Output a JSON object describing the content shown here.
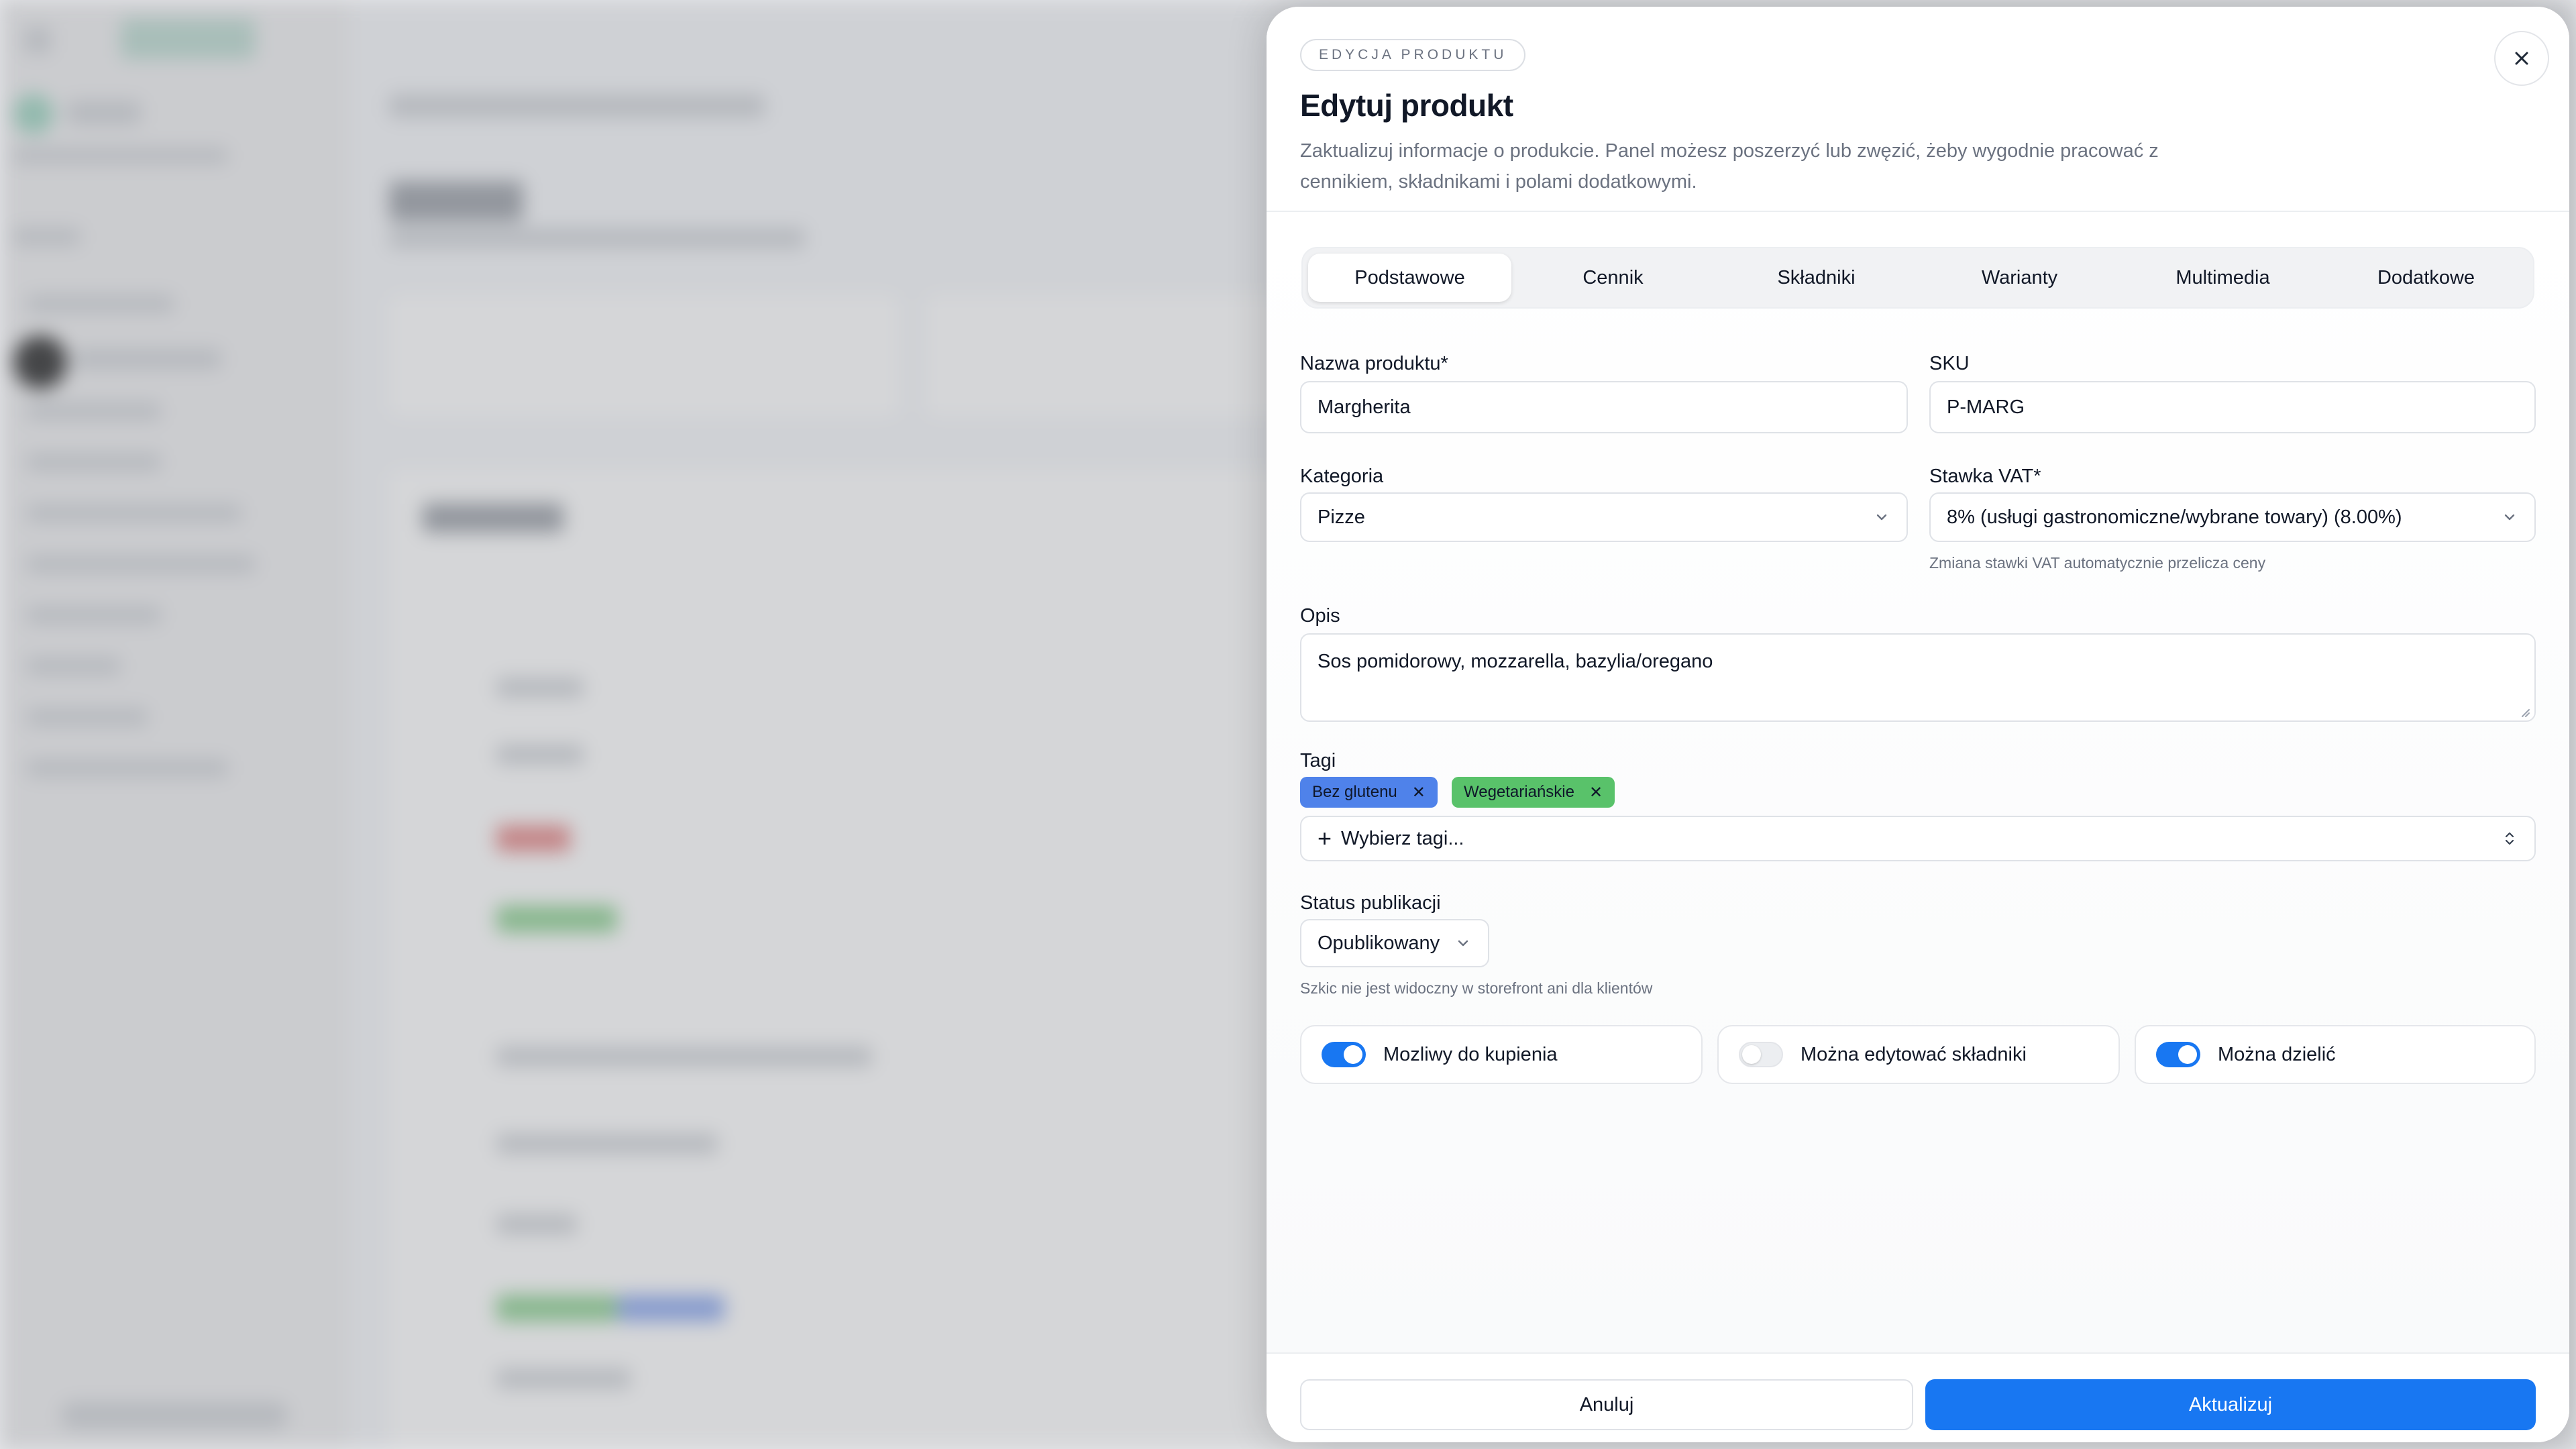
{
  "drawer": {
    "eyebrow": "EDYCJA PRODUKTU",
    "title": "Edytuj produkt",
    "description": "Zaktualizuj informacje o produkcie. Panel możesz poszerzyć lub zwęzić, żeby wygodnie pracować z cennikiem, składnikami i polami dodatkowymi.",
    "close_icon": "close-icon"
  },
  "tabs": [
    {
      "label": "Podstawowe",
      "active": true
    },
    {
      "label": "Cennik",
      "active": false
    },
    {
      "label": "Składniki",
      "active": false
    },
    {
      "label": "Warianty",
      "active": false
    },
    {
      "label": "Multimedia",
      "active": false
    },
    {
      "label": "Dodatkowe",
      "active": false
    }
  ],
  "form": {
    "name": {
      "label": "Nazwa produktu*",
      "value": "Margherita"
    },
    "sku": {
      "label": "SKU",
      "value": "P-MARG"
    },
    "category": {
      "label": "Kategoria",
      "value": "Pizze"
    },
    "vat": {
      "label": "Stawka VAT*",
      "value": "8% (usługi gastronomiczne/wybrane towary) (8.00%)",
      "hint": "Zmiana stawki VAT automatycznie przelicza ceny"
    },
    "description": {
      "label": "Opis",
      "value": "Sos pomidorowy, mozzarella, bazylia/oregano"
    },
    "tags": {
      "label": "Tagi",
      "items": [
        {
          "label": "Bez glutenu",
          "color": "#4f82ea"
        },
        {
          "label": "Wegetariańskie",
          "color": "#59c26a"
        }
      ],
      "remove_symbol": "✕",
      "picker_plus": "+",
      "picker_placeholder": "Wybierz tagi..."
    },
    "status": {
      "label": "Status publikacji",
      "value": "Opublikowany",
      "hint": "Szkic nie jest widoczny w storefront ani dla klientów"
    },
    "switches": [
      {
        "label": "Mozliwy do kupienia",
        "on": true
      },
      {
        "label": "Można edytować składniki",
        "on": false
      },
      {
        "label": "Można dzielić",
        "on": true
      }
    ]
  },
  "footer": {
    "cancel_label": "Anuluj",
    "submit_label": "Aktualizuj"
  },
  "colors": {
    "accent": "#1877f2",
    "tag_blue": "#4f82ea",
    "tag_green": "#59c26a"
  }
}
